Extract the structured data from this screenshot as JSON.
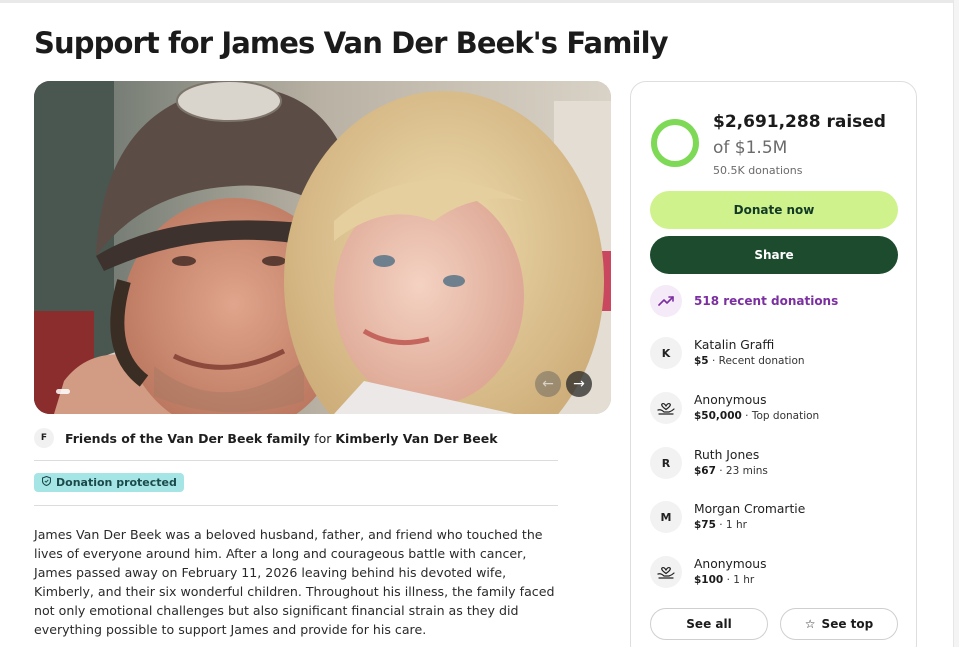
{
  "page": {
    "title": "Support for James Van Der Beek's Family"
  },
  "organizer": {
    "avatar_initial": "F",
    "name": "Friends of the Van Der Beek family",
    "connector": " for ",
    "beneficiary": "Kimberly Van Der Beek"
  },
  "badge": {
    "label": "Donation protected"
  },
  "story": {
    "text": "James Van Der Beek was a beloved husband, father, and friend who touched the lives of everyone around him. After a long and courageous battle with cancer, James passed away on February 11, 2026 leaving behind his devoted wife, Kimberly, and their six wonderful children. Throughout his illness, the family faced not only emotional challenges but also significant financial strain as they did everything possible to support James and provide for his care."
  },
  "carousel": {
    "prev": "←",
    "next": "→"
  },
  "progress": {
    "raised": "$2,691,288 raised",
    "goal": "of $1.5M",
    "donations": "50.5K donations",
    "ring_fraction": 1.0,
    "ring_color": "#7ed957"
  },
  "actions": {
    "donate": "Donate now",
    "share": "Share"
  },
  "recent": {
    "label": "518 recent donations",
    "icon": "trending-up-icon"
  },
  "donors": [
    {
      "initial": "K",
      "icon": "",
      "name": "Katalin Graffi",
      "amount": "$5",
      "detail": " · Recent donation"
    },
    {
      "initial": "",
      "icon": "heart-hand-icon",
      "name": "Anonymous",
      "amount": "$50,000",
      "detail": " · Top donation"
    },
    {
      "initial": "R",
      "icon": "",
      "name": "Ruth Jones",
      "amount": "$67",
      "detail": " · 23 mins"
    },
    {
      "initial": "M",
      "icon": "",
      "name": "Morgan Cromartie",
      "amount": "$75",
      "detail": " · 1 hr"
    },
    {
      "initial": "",
      "icon": "heart-hand-icon",
      "name": "Anonymous",
      "amount": "$100",
      "detail": " · 1 hr"
    }
  ],
  "buttons": {
    "see_all": "See all",
    "see_top": "See top",
    "star": "☆"
  },
  "colors": {
    "accent_green": "#cff28c",
    "dark_green": "#1d4b2e",
    "purple": "#7b2fa0",
    "badge": "#a6e5e5"
  }
}
